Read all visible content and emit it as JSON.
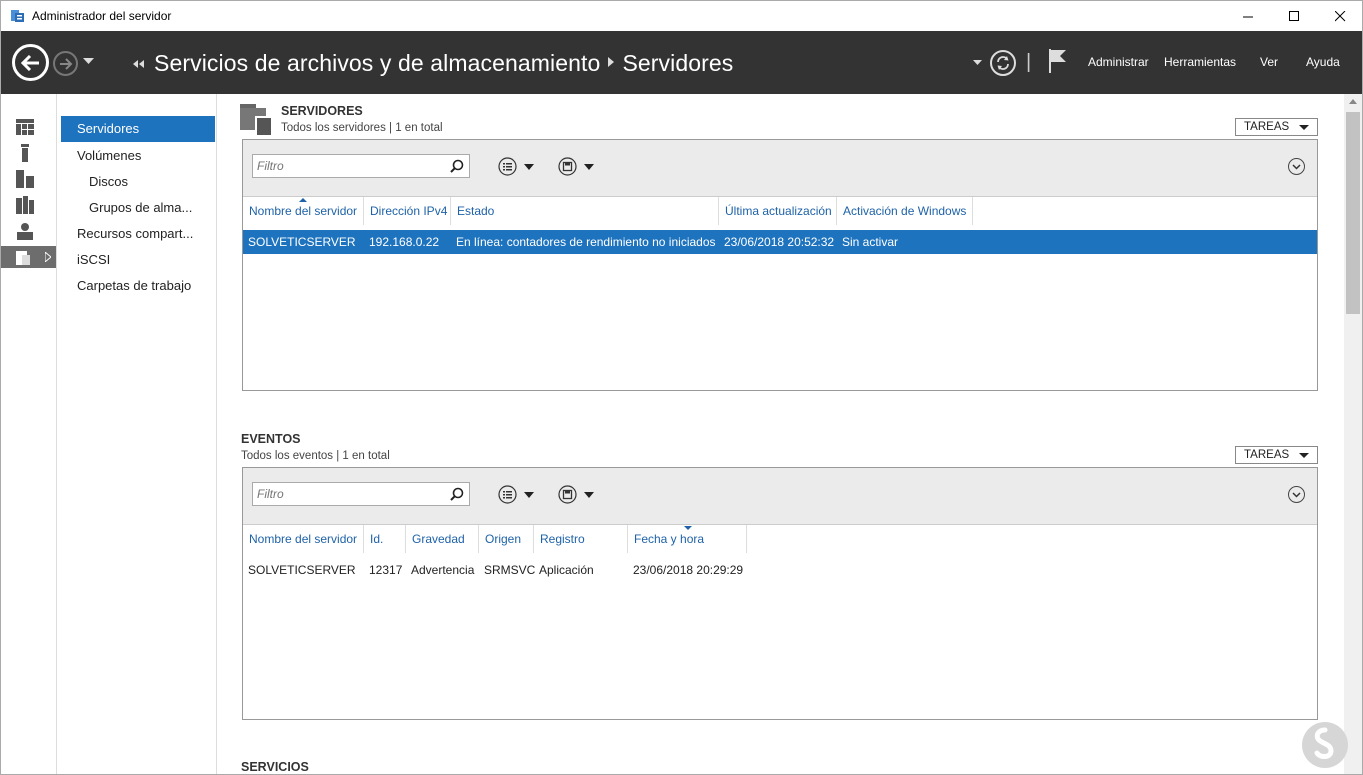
{
  "window": {
    "title": "Administrador del servidor"
  },
  "header": {
    "breadcrumb_root": "Servicios de archivos y de almacenamiento",
    "breadcrumb_current": "Servidores",
    "menu": [
      "Administrar",
      "Herramientas",
      "Ver",
      "Ayuda"
    ]
  },
  "icon_strip": [
    "dashboard-icon",
    "local-server-icon",
    "all-servers-icon",
    "file-services-icon",
    "iis-icon",
    "file-storage-icon"
  ],
  "nav": {
    "items": [
      {
        "label": "Servidores",
        "active": true
      },
      {
        "label": "Volúmenes"
      },
      {
        "label": "Discos"
      },
      {
        "label": "Grupos de alma..."
      },
      {
        "label": "Recursos compart..."
      },
      {
        "label": "iSCSI"
      },
      {
        "label": "Carpetas de trabajo"
      }
    ]
  },
  "servers": {
    "title": "SERVIDORES",
    "subtitle": "Todos los servidores | 1 en total",
    "tasks": "TAREAS",
    "filter_placeholder": "Filtro",
    "columns": [
      "Nombre del servidor",
      "Dirección IPv4",
      "Estado",
      "Última actualización",
      "Activación de Windows"
    ],
    "rows": [
      [
        "SOLVETICSERVER",
        "192.168.0.22",
        "En línea: contadores de rendimiento no iniciados",
        "23/06/2018 20:52:32",
        "Sin activar"
      ]
    ]
  },
  "events": {
    "title": "EVENTOS",
    "subtitle": "Todos los eventos | 1 en total",
    "tasks": "TAREAS",
    "filter_placeholder": "Filtro",
    "columns": [
      "Nombre del servidor",
      "Id.",
      "Gravedad",
      "Origen",
      "Registro",
      "Fecha y hora"
    ],
    "rows": [
      [
        "SOLVETICSERVER",
        "12317",
        "Advertencia",
        "SRMSVC",
        "Aplicación",
        "23/06/2018 20:29:29"
      ]
    ]
  },
  "services": {
    "title": "SERVICIOS"
  },
  "colors": {
    "header_bg": "#333333",
    "accent": "#1e73be",
    "link": "#1e62a8"
  }
}
